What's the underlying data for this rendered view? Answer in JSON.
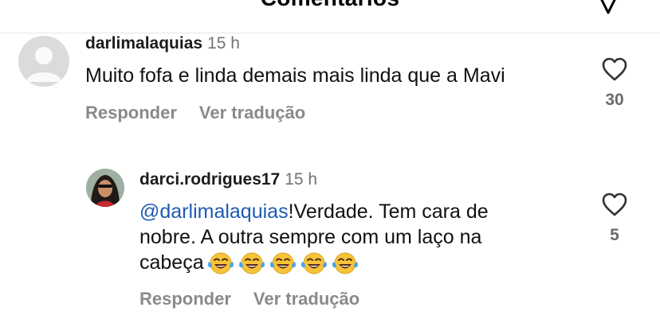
{
  "header": {
    "title": "Comentários",
    "icon": "send-icon"
  },
  "comments": [
    {
      "username": "darlimalaquias",
      "time": "15 h",
      "text": "Muito fofa e linda demais mais linda que a Mavi",
      "reply_label": "Responder",
      "translate_label": "Ver tradução",
      "likes": "30",
      "avatar": "default-avatar"
    },
    {
      "username": "darci.rodrigues17",
      "time": "15 h",
      "mention": "@darlimalaquias",
      "text_line1": "!Verdade. Tem cara de",
      "text_line2": "nobre. A outra sempre com um laço na",
      "text_line3": "cabeça",
      "emoji_count": 5,
      "reply_label": "Responder",
      "translate_label": "Ver tradução",
      "likes": "5",
      "avatar": "user-photo-avatar"
    }
  ],
  "colors": {
    "mention": "#1d5bb3",
    "muted": "#8a8a8a"
  }
}
